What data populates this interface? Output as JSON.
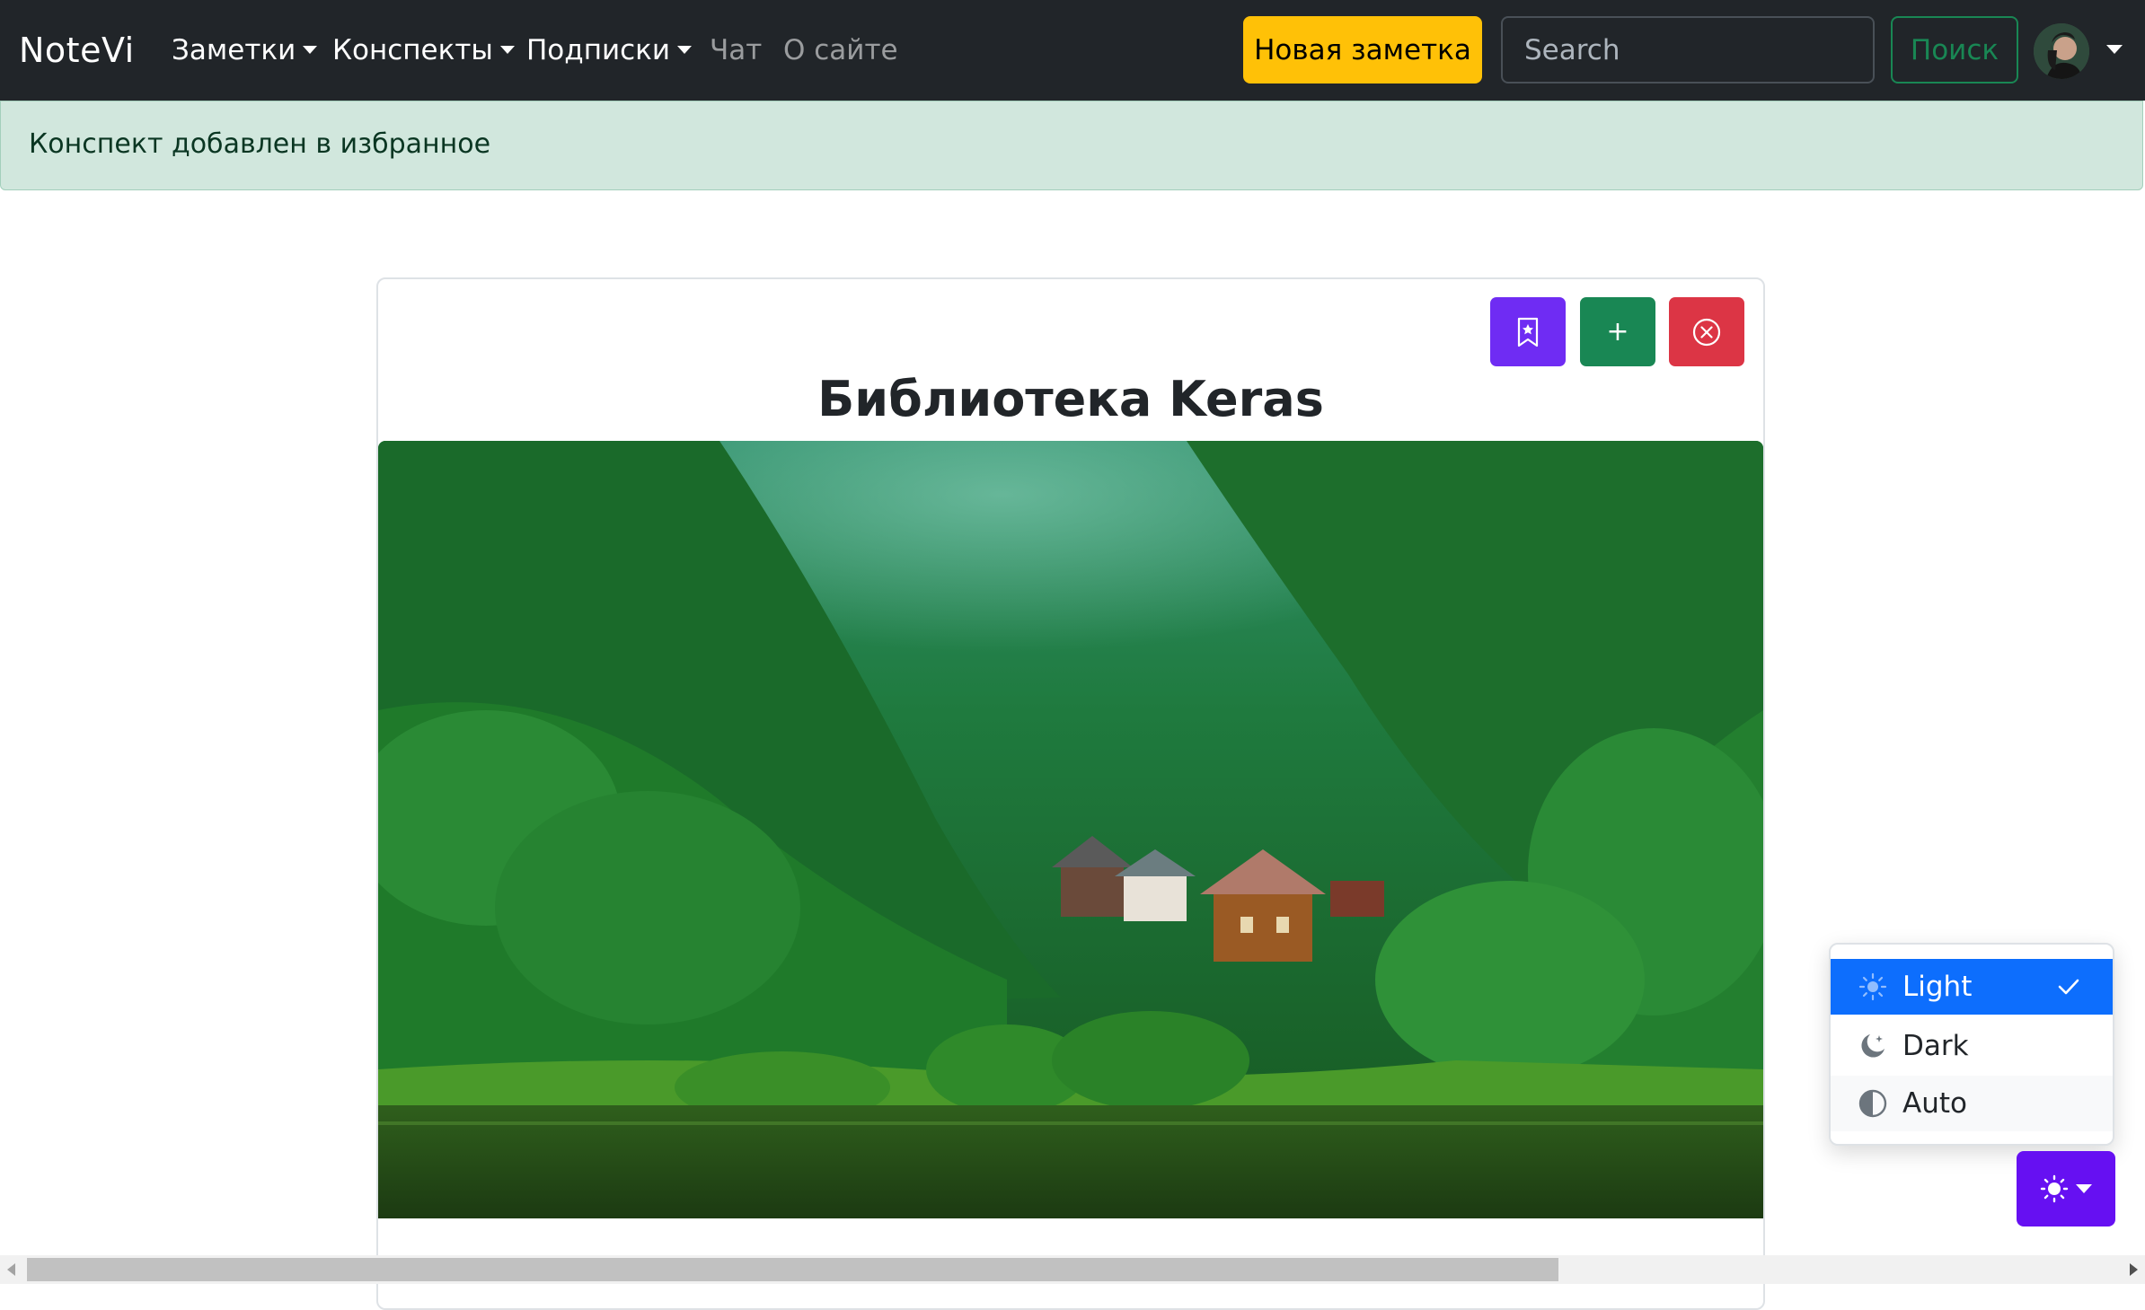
{
  "navbar": {
    "brand": "NoteVi",
    "items": [
      {
        "label": "Заметки",
        "dropdown": true
      },
      {
        "label": "Конспекты",
        "dropdown": true
      },
      {
        "label": "Подписки",
        "dropdown": true
      },
      {
        "label": "Чат",
        "dropdown": false
      },
      {
        "label": "О сайте",
        "dropdown": false
      }
    ],
    "new_note_label": "Новая заметка",
    "search_placeholder": "Search",
    "search_button_label": "Поиск"
  },
  "alert": {
    "text": "Конспект добавлен в избранное"
  },
  "card": {
    "title": "Библиотека Keras",
    "actions": [
      {
        "icon": "bookmark-star-icon",
        "color": "#6f2cf3"
      },
      {
        "icon": "plus-icon",
        "label": "+",
        "color": "#198754"
      },
      {
        "icon": "close-circle-icon",
        "color": "#dc3545"
      }
    ]
  },
  "theme": {
    "options": [
      {
        "label": "Light",
        "icon": "sun-icon",
        "selected": true
      },
      {
        "label": "Dark",
        "icon": "moon-stars-icon",
        "selected": false
      },
      {
        "label": "Auto",
        "icon": "half-circle-icon",
        "selected": false
      }
    ],
    "toggle_icon": "sun-icon"
  },
  "colors": {
    "navbar_bg": "#212529",
    "warning": "#ffc107",
    "success": "#198754",
    "alert_bg": "#d1e7dd",
    "primary": "#0d6efd",
    "indigo": "#6610f2"
  }
}
